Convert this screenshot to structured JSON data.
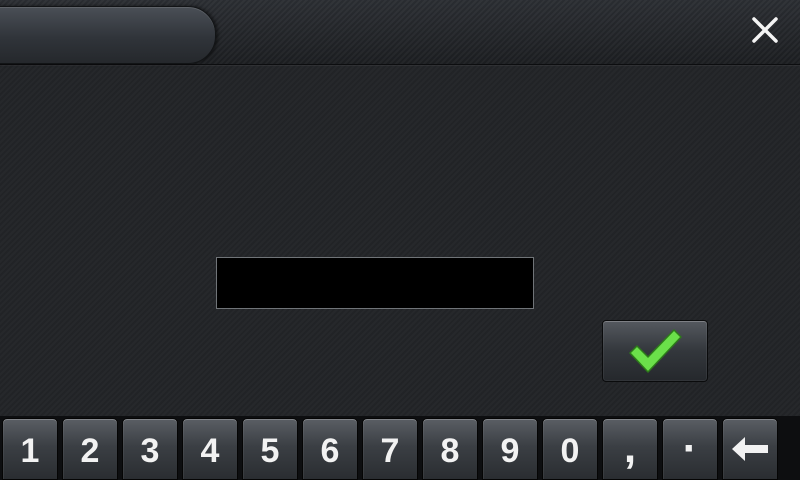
{
  "title_bar": {
    "title": "",
    "close_icon": "close-icon"
  },
  "input": {
    "value": "",
    "placeholder": ""
  },
  "confirm": {
    "icon": "checkmark-icon",
    "color": "#6be04a"
  },
  "keyboard": {
    "keys": [
      "1",
      "2",
      "3",
      "4",
      "5",
      "6",
      "7",
      "8",
      "9",
      "0",
      ",",
      "·"
    ],
    "backspace_icon": "backspace-arrow-icon"
  }
}
